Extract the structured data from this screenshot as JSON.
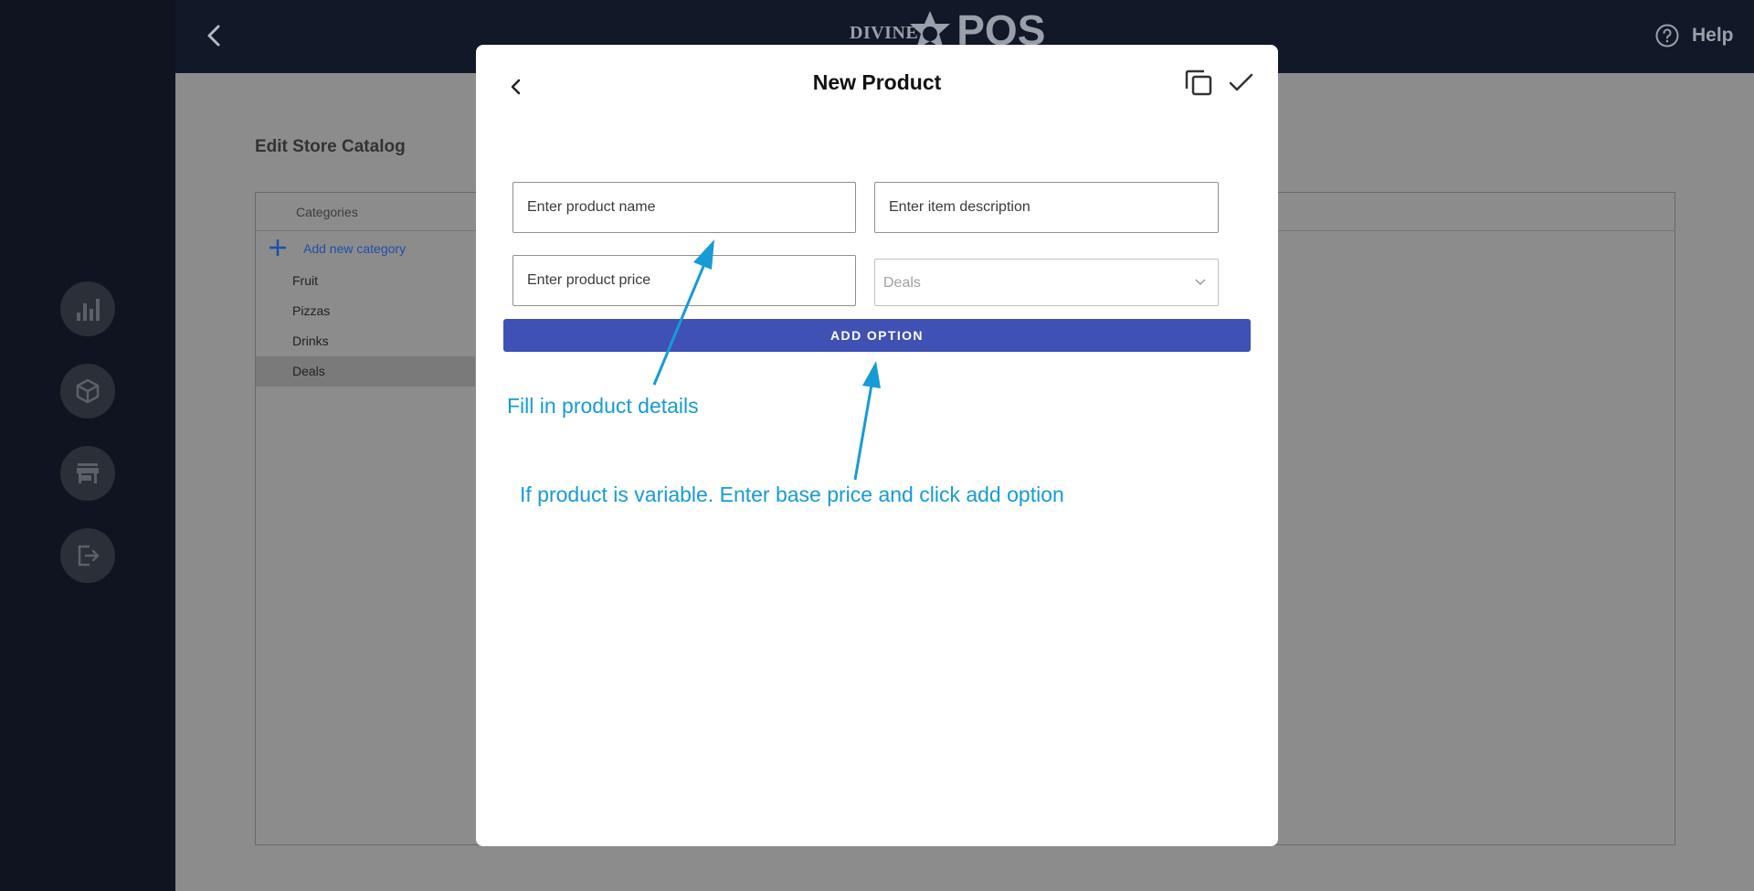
{
  "header": {
    "logo_small": "DIVINE",
    "logo_large": "POS",
    "help_label": "Help"
  },
  "sidebar": {
    "icons": [
      "bar-chart-icon",
      "box-icon",
      "store-icon",
      "logout-icon"
    ]
  },
  "page": {
    "title": "Edit Store Catalog",
    "categories_header": "Categories",
    "add_category_label": "Add new category",
    "categories": [
      {
        "label": "Fruit",
        "selected": false
      },
      {
        "label": "Pizzas",
        "selected": false
      },
      {
        "label": "Drinks",
        "selected": false
      },
      {
        "label": "Deals",
        "selected": true
      }
    ]
  },
  "modal": {
    "title": "New Product",
    "fields": {
      "name_placeholder": "Enter product name",
      "description_placeholder": "Enter item description",
      "price_placeholder": "Enter product price",
      "category_value": "Deals"
    },
    "add_option_label": "ADD OPTION"
  },
  "annotations": {
    "details": "Fill in product details",
    "variable": "If product is variable. Enter base price and click add option"
  },
  "colors": {
    "topbar": "#111827",
    "accent": "#3f51b5",
    "annotation": "#169bd5",
    "link": "#1f4fa8"
  }
}
